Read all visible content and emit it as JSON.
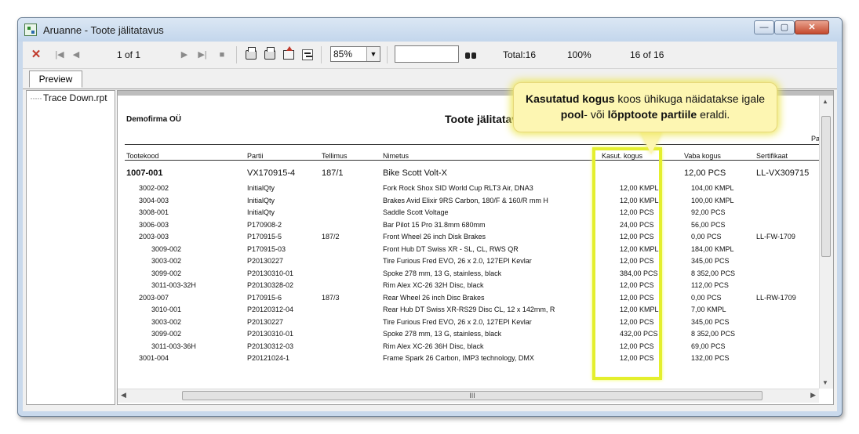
{
  "window": {
    "title": "Aruanne - Toote jälitatavus",
    "min_icon": "minimize-icon",
    "max_icon": "maximize-icon",
    "close_icon": "close-icon"
  },
  "toolbar": {
    "page_indicator": "1 of 1",
    "zoom_value": "85%",
    "search_value": "",
    "total": "Total:16",
    "percent": "100%",
    "records": "16 of 16"
  },
  "tabs": [
    "Preview"
  ],
  "tree": {
    "item": "Trace Down.rpt"
  },
  "report": {
    "company": "Demofirma OÜ",
    "title": "Toote jälitatavus",
    "pa": "Pa",
    "columns": [
      "Tootekood",
      "Partii",
      "Tellimus",
      "Nimetus",
      "Kasut. kogus",
      "Vaba kogus",
      "Sertifikaat"
    ],
    "main_row": {
      "code": "1007-001",
      "batch": "VX170915-4",
      "order": "187/1",
      "name": "Bike Scott Volt-X",
      "used": "",
      "free": "12,00 PCS",
      "cert": "LL-VX309715"
    },
    "rows": [
      {
        "code": "3002-002",
        "batch": "InitialQty",
        "order": "",
        "name": "Fork Rock Shox SID World Cup RLT3 Air, DNA3",
        "used": "12,00 KMPL",
        "free": "104,00 KMPL",
        "cert": ""
      },
      {
        "code": "3004-003",
        "batch": "InitialQty",
        "order": "",
        "name": "Brakes Avid Elixir 9RS Carbon, 180/F & 160/R mm H",
        "used": "12,00 KMPL",
        "free": "100,00 KMPL",
        "cert": ""
      },
      {
        "code": "3008-001",
        "batch": "InitialQty",
        "order": "",
        "name": "Saddle Scott Voltage",
        "used": "12,00 PCS",
        "free": "92,00 PCS",
        "cert": ""
      },
      {
        "code": "3006-003",
        "batch": "P170908-2",
        "order": "",
        "name": "Bar Pilot 15 Pro 31.8mm 680mm",
        "used": "24,00 PCS",
        "free": "56,00 PCS",
        "cert": ""
      },
      {
        "code": "2003-003",
        "batch": "P170915-5",
        "order": "187/2",
        "name": "Front Wheel 26 inch Disk Brakes",
        "used": "12,00 PCS",
        "free": "0,00 PCS",
        "cert": "LL-FW-1709"
      },
      {
        "code": "3009-002",
        "batch": "P170915-03",
        "order": "",
        "name": "Front Hub DT Swiss XR - SL, CL, RWS QR",
        "used": "12,00 KMPL",
        "free": "184,00 KMPL",
        "cert": ""
      },
      {
        "code": "3003-002",
        "batch": "P20130227",
        "order": "",
        "name": "Tire Furious Fred EVO, 26 x 2.0, 127EPI Kevlar",
        "used": "12,00 PCS",
        "free": "345,00 PCS",
        "cert": ""
      },
      {
        "code": "3099-002",
        "batch": "P20130310-01",
        "order": "",
        "name": "Spoke 278 mm, 13 G, stainless, black",
        "used": "384,00 PCS",
        "free": "8 352,00 PCS",
        "cert": ""
      },
      {
        "code": "3011-003-32H",
        "batch": "P20130328-02",
        "order": "",
        "name": "Rim Alex XC-26 32H Disc, black",
        "used": "12,00 PCS",
        "free": "112,00 PCS",
        "cert": ""
      },
      {
        "code": "2003-007",
        "batch": "P170915-6",
        "order": "187/3",
        "name": "Rear Wheel 26 inch Disc Brakes",
        "used": "12,00 PCS",
        "free": "0,00 PCS",
        "cert": "LL-RW-1709"
      },
      {
        "code": "3010-001",
        "batch": "P20120312-04",
        "order": "",
        "name": "Rear Hub DT Swiss XR-RS29 Disc CL, 12 x 142mm, R",
        "used": "12,00 KMPL",
        "free": "7,00 KMPL",
        "cert": ""
      },
      {
        "code": "3003-002",
        "batch": "P20130227",
        "order": "",
        "name": "Tire Furious Fred EVO, 26 x 2.0, 127EPI Kevlar",
        "used": "12,00 PCS",
        "free": "345,00 PCS",
        "cert": ""
      },
      {
        "code": "3099-002",
        "batch": "P20130310-01",
        "order": "",
        "name": "Spoke 278 mm, 13 G, stainless, black",
        "used": "432,00 PCS",
        "free": "8 352,00 PCS",
        "cert": ""
      },
      {
        "code": "3011-003-36H",
        "batch": "P20130312-03",
        "order": "",
        "name": "Rim Alex XC-26 36H Disc, black",
        "used": "12,00 PCS",
        "free": "69,00 PCS",
        "cert": ""
      },
      {
        "code": "3001-004",
        "batch": "P20121024-1",
        "order": "",
        "name": "Frame Spark 26 Carbon, IMP3 technology, DMX",
        "used": "12,00 PCS",
        "free": "132,00 PCS",
        "cert": ""
      }
    ]
  },
  "callout": {
    "bold1": "Kasutatud kogus",
    "text1": " koos ühikuga näidatakse igale ",
    "bold2": "pool",
    "text2": "- või ",
    "bold3": "lõpptoote partiile",
    "text3": " eraldi."
  },
  "scrollbar": {
    "grip": "III"
  },
  "colors": {
    "highlight": "#e4ef2d",
    "callout_bg": "#fdf6b2",
    "close_button": "#c44a2e"
  }
}
